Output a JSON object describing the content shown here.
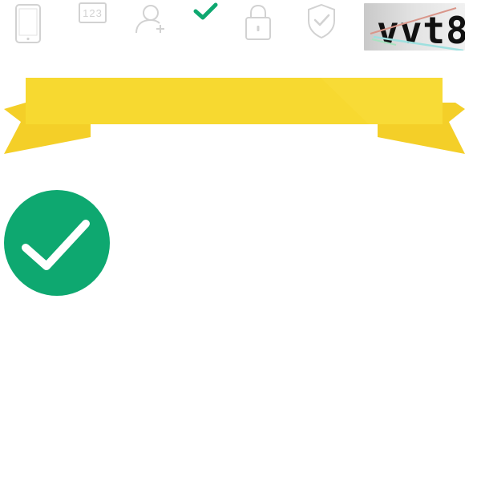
{
  "steps": {
    "items": [
      {
        "icon": "phone-icon",
        "state": "pending"
      },
      {
        "icon": "keypad-123-icon",
        "state": "pending",
        "label": "123"
      },
      {
        "icon": "add-user-icon",
        "state": "pending"
      },
      {
        "icon": "checkmark-icon",
        "state": "completed"
      },
      {
        "icon": "lock-icon",
        "state": "pending"
      },
      {
        "icon": "shield-check-icon",
        "state": "pending"
      }
    ]
  },
  "captcha": {
    "text": "vvt8"
  },
  "banner": {
    "icon": "ribbon-banner",
    "color": "#f7d930"
  },
  "result": {
    "icon": "success-check-icon",
    "color": "#0ea870"
  },
  "colors": {
    "inactive": "#d2d2d2",
    "active": "#0ea870"
  }
}
